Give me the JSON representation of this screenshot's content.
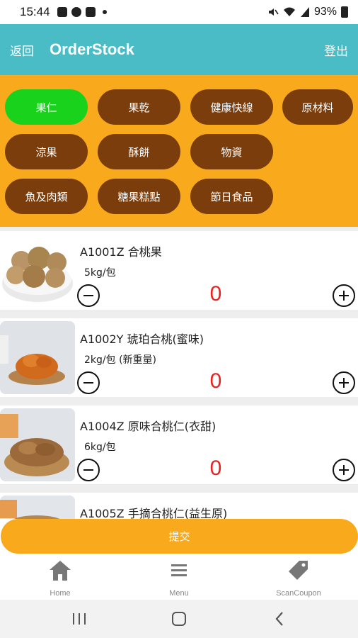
{
  "status_bar": {
    "time": "15:44",
    "battery": "93%"
  },
  "app_bar": {
    "back_label": "返回",
    "title": "OrderStock",
    "logout_label": "登出"
  },
  "categories": [
    {
      "label": "果仁",
      "active": true
    },
    {
      "label": "果乾",
      "active": false
    },
    {
      "label": "健康快線",
      "active": false
    },
    {
      "label": "原材料",
      "active": false
    },
    {
      "label": "涼果",
      "active": false
    },
    {
      "label": "酥餅",
      "active": false
    },
    {
      "label": "物資",
      "active": false
    },
    {
      "label": "魚及肉類",
      "active": false
    },
    {
      "label": "糖果糕點",
      "active": false
    },
    {
      "label": "節日食品",
      "active": false
    }
  ],
  "products": [
    {
      "name": "A1001Z 合桃果",
      "unit": "5kg/包",
      "qty": "0"
    },
    {
      "name": "A1002Y 琥珀合桃(蜜味)",
      "unit": "2kg/包 (新重量)",
      "qty": "0"
    },
    {
      "name": "A1004Z 原味合桃仁(衣甜)",
      "unit": "6kg/包",
      "qty": "0"
    },
    {
      "name": "A1005Z 手摘合桃仁(益生原)",
      "unit": "",
      "qty": ""
    }
  ],
  "submit_label": "提交",
  "bottom_nav": [
    {
      "label": "Home",
      "icon": "home-icon"
    },
    {
      "label": "Menu",
      "icon": "menu-icon"
    },
    {
      "label": "ScanCoupon",
      "icon": "tag-icon"
    }
  ],
  "colors": {
    "app_bar": "#49BCC6",
    "category_bg": "#F8A91C",
    "chip": "#7B3D0B",
    "chip_active": "#19D21B",
    "qty": "#E8231F"
  }
}
